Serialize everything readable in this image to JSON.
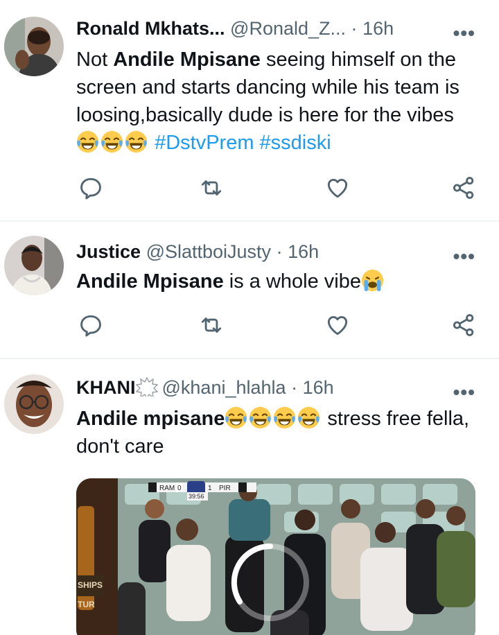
{
  "tweets": [
    {
      "name": "Ronald Mkhats...",
      "handle": "@Ronald_Z...",
      "dot": "·",
      "time": "16h",
      "text_prefix": "Not ",
      "text_bold": "Andile Mpisane",
      "text_rest": " seeing himself on the screen and starts dancing while his team is loosing,basically dude is here for the vibes",
      "hashtags": [
        "#DstvPrem",
        "#ssdiski"
      ]
    },
    {
      "name": "Justice",
      "handle": "@SlattboiJusty",
      "dot": "·",
      "time": "16h",
      "text_bold": "Andile Mpisane",
      "text_rest": " is a whole vibe"
    },
    {
      "name": "KHANI",
      "handle": "@khani_hlahla",
      "dot": "·",
      "time": "16h",
      "text_bold": "Andile mpisane",
      "text_rest": " stress free fella, don't care"
    }
  ],
  "more_label": "•••",
  "scoreboard": {
    "home": "RAM",
    "home_score": "0",
    "away_score": "1",
    "away": "PIR",
    "clock": "39:56"
  },
  "media_signs": {
    "left_top": "SHIPS",
    "left_bottom": "TUR"
  },
  "colors": {
    "link": "#1d9bf0",
    "secondary": "#536471",
    "divider": "#eff3f4"
  },
  "icons": [
    "reply-icon",
    "retweet-icon",
    "like-icon",
    "share-icon",
    "more-icon",
    "laughing-emoji",
    "crying-emoji",
    "anger-symbol-icon"
  ]
}
